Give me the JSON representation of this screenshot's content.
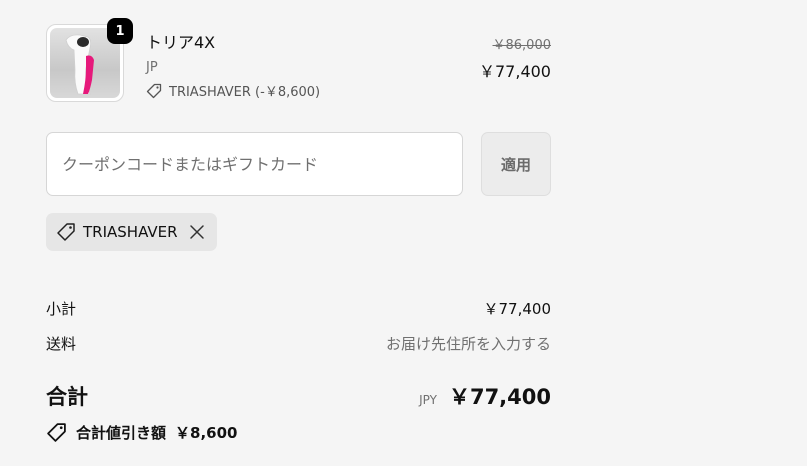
{
  "product": {
    "quantity": "1",
    "name": "トリア4X",
    "variant": "JP",
    "discount_line": "TRIASHAVER (-￥8,600)",
    "original_price": "￥86,000",
    "price": "￥77,400",
    "image_icon": "hair-removal-device-image"
  },
  "coupon": {
    "placeholder": "クーポンコードまたはギフトカード",
    "value": "",
    "apply_label": "適用"
  },
  "applied_code": {
    "label": "TRIASHAVER",
    "tag_icon": "tag-icon",
    "remove_icon": "close-icon"
  },
  "summary": {
    "subtotal_label": "小計",
    "subtotal_value": "￥77,400",
    "shipping_label": "送料",
    "shipping_value": "お届け先住所を入力する",
    "total_label": "合計",
    "currency": "JPY",
    "total_value": "￥77,400",
    "savings_label": "合計値引き額",
    "savings_value": "￥8,600"
  },
  "colors": {
    "background": "#f5f5f5",
    "device_accent": "#e6197b"
  }
}
